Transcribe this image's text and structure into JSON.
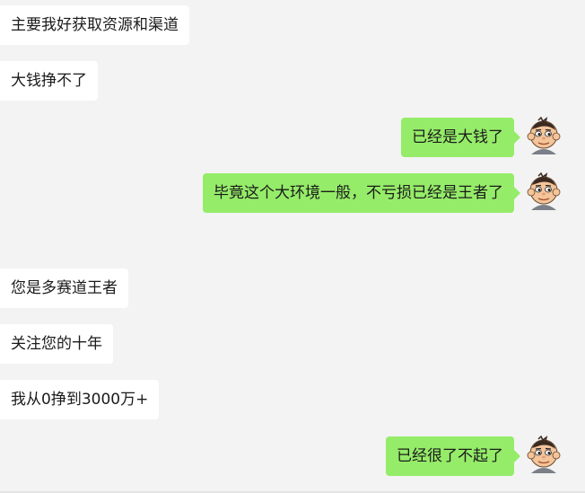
{
  "messages": [
    {
      "side": "in",
      "text": "主要我好获取资源和渠道"
    },
    {
      "side": "in",
      "text": "大钱挣不了"
    },
    {
      "side": "out",
      "text": "已经是大钱了"
    },
    {
      "side": "out",
      "text": "毕竟这个大环境一般，不亏损已经是王者了"
    },
    {
      "side": "in",
      "text": "您是多赛道王者"
    },
    {
      "side": "in",
      "text": "关注您的十年"
    },
    {
      "side": "in",
      "text": "我从0挣到3000万+"
    },
    {
      "side": "out",
      "text": "已经很了不起了"
    }
  ],
  "colors": {
    "background": "#f3f3f3",
    "incoming_bubble": "#ffffff",
    "outgoing_bubble": "#95ec69"
  },
  "avatar_icon": "cartoon-boy-avatar-icon"
}
